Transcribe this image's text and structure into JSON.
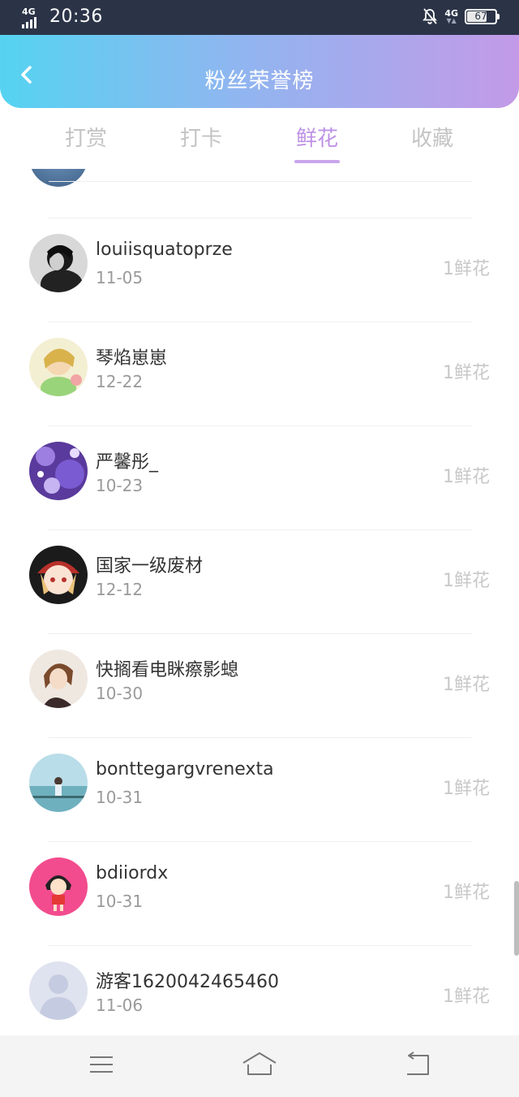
{
  "status": {
    "signal_label": "4G",
    "time": "20:36",
    "network_label": "4G",
    "battery": "67",
    "battery_level": 0.67
  },
  "header": {
    "title": "粉丝荣誉榜",
    "back_icon": "chevron-left-icon"
  },
  "tabs": [
    {
      "label": "打赏",
      "active": false
    },
    {
      "label": "打卡",
      "active": false
    },
    {
      "label": "鲜花",
      "active": true
    },
    {
      "label": "收藏",
      "active": false
    }
  ],
  "list": [
    {
      "name": "louiisquatoprze",
      "date": "11-05",
      "count": "1鲜花"
    },
    {
      "name": "琴焰崽崽",
      "date": "12-22",
      "count": "1鲜花"
    },
    {
      "name": "严馨彤_",
      "date": "10-23",
      "count": "1鲜花"
    },
    {
      "name": "国家一级废材",
      "date": "12-12",
      "count": "1鲜花"
    },
    {
      "name": "快搁看电眯瘵影螅",
      "date": "10-30",
      "count": "1鲜花"
    },
    {
      "name": "bonttegargvrenexta",
      "date": "10-31",
      "count": "1鲜花"
    },
    {
      "name": "bdiiordx",
      "date": "10-31",
      "count": "1鲜花"
    },
    {
      "name": "游客1620042465460",
      "date": "11-06",
      "count": "1鲜花"
    }
  ],
  "navbar": {
    "menu_icon": "menu-icon",
    "home_icon": "home-icon",
    "back_icon": "back-arrow-icon"
  },
  "colors": {
    "header_gradient_start": "#55d3f1",
    "header_gradient_end": "#c39ae8",
    "active_tab": "#be92e6",
    "status_bar": "#2b3447"
  }
}
